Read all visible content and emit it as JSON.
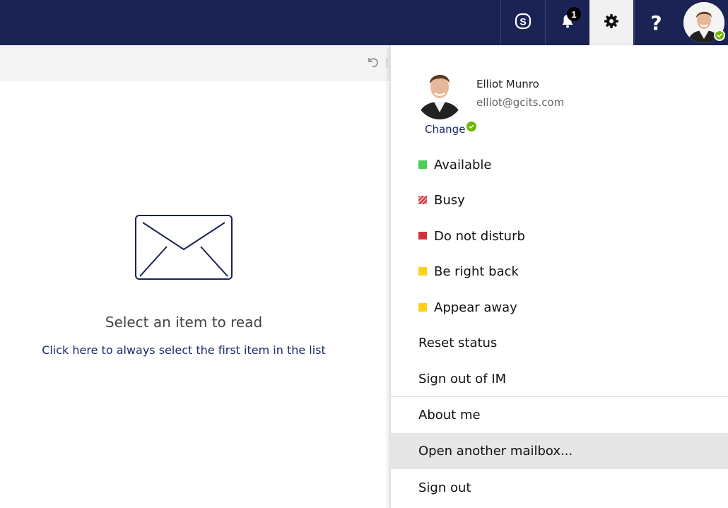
{
  "topbar": {
    "skype_icon": "skype-icon",
    "bell_icon": "bell-icon",
    "notification_count": "1",
    "settings_icon": "gear-icon",
    "help_label": "?",
    "account_icon": "avatar",
    "bar_color": "#1b2355"
  },
  "reading_pane": {
    "message": "Select an item to read",
    "link": "Click here to always select the first item in the list"
  },
  "profile": {
    "name": "Elliot Munro",
    "email": "elliot@gcits.com",
    "change_label": "Change",
    "presence_color": "#6bb700"
  },
  "status_options": [
    {
      "label": "Available",
      "color": "#4ccf55"
    },
    {
      "label": "Busy",
      "color": "#d13438"
    },
    {
      "label": "Do not disturb",
      "color": "#d13438"
    },
    {
      "label": "Be right back",
      "color": "#fcd116"
    },
    {
      "label": "Appear away",
      "color": "#fcd116"
    }
  ],
  "menu": {
    "reset_status": "Reset status",
    "sign_out_im": "Sign out of IM",
    "about_me": "About me",
    "open_mailbox": "Open another mailbox...",
    "sign_out": "Sign out"
  }
}
